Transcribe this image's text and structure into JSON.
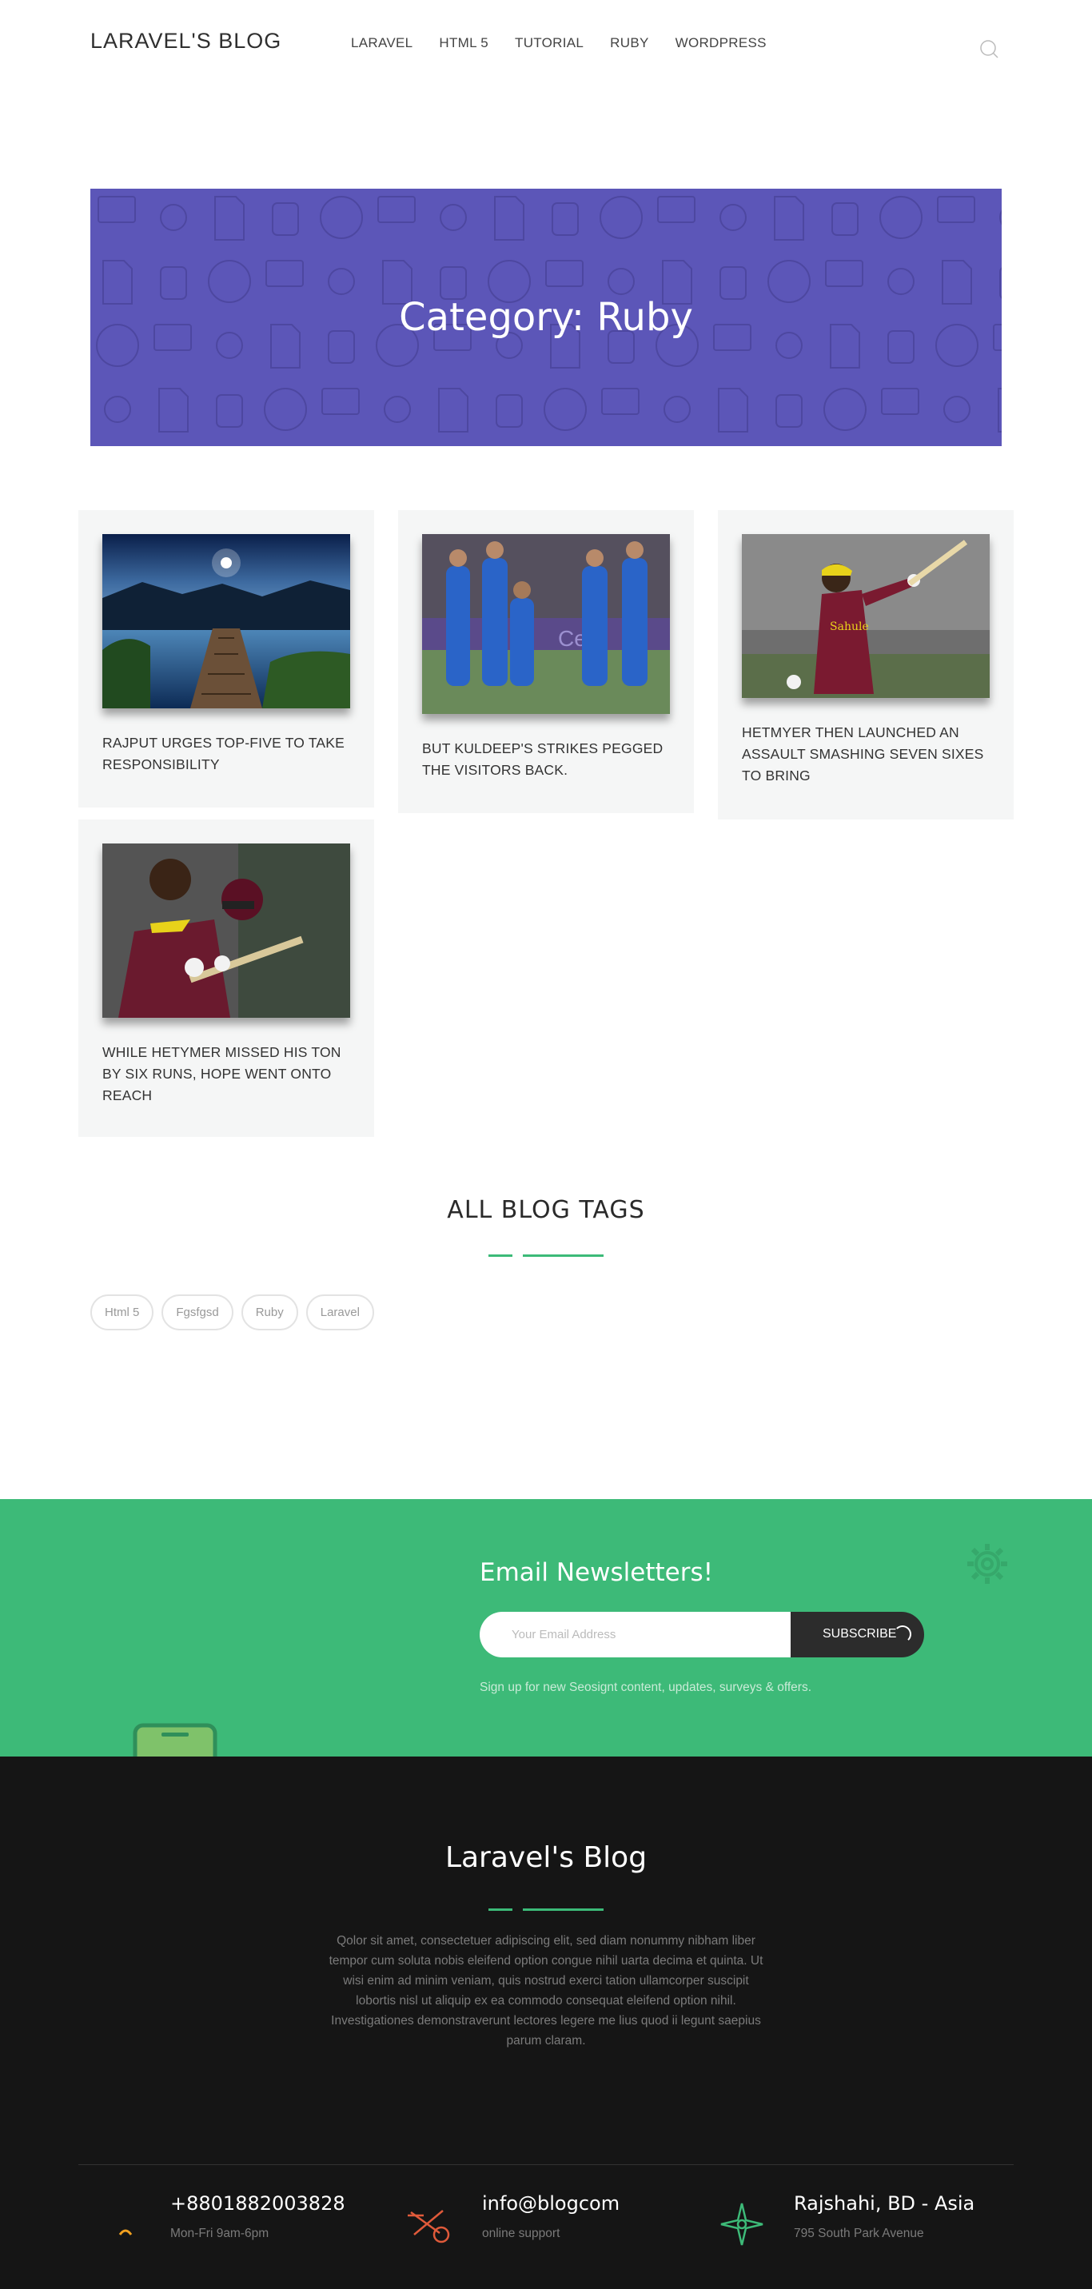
{
  "header": {
    "logo": "LARAVEL'S BLOG",
    "nav": [
      "LARAVEL",
      "HTML 5",
      "TUTORIAL",
      "RUBY",
      "WORDPRESS"
    ]
  },
  "hero": {
    "title": "Category: Ruby",
    "bg_color": "#5c56b8"
  },
  "posts": [
    {
      "title": "RAJPUT URGES TOP-FIVE TO TAKE RESPONSIBILITY"
    },
    {
      "title": "BUT KULDEEP'S STRIKES PEGGED THE VISITORS BACK."
    },
    {
      "title": "HETMYER THEN LAUNCHED AN ASSAULT SMASHING SEVEN SIXES TO BRING"
    },
    {
      "title": "WHILE HETYMER MISSED HIS TON BY SIX RUNS, HOPE WENT ONTO REACH"
    }
  ],
  "tags_section": {
    "title": "ALL BLOG TAGS",
    "tags": [
      "Html 5",
      "Fgsfgsd",
      "Ruby",
      "Laravel"
    ]
  },
  "newsletter": {
    "title": "Email Newsletters!",
    "placeholder": "Your Email Address",
    "button": "SUBSCRIBE",
    "note": "Sign up for new Seosignt content, updates, surveys & offers.",
    "bg_color": "#3dba78"
  },
  "footer": {
    "title": "Laravel's Blog",
    "text": "Qolor sit amet, consectetuer adipiscing elit, sed diam nonummy nibham liber tempor cum soluta nobis eleifend option congue nihil uarta decima et quinta. Ut wisi enim ad minim veniam, quis nostrud exerci tation ullamcorper suscipit lobortis nisl ut aliquip ex ea commodo consequat eleifend option nihil. Investigationes demonstraverunt lectores legere me lius quod ii legunt saepius parum claram.",
    "contacts": [
      {
        "main": "+8801882003828",
        "sub": "Mon-Fri 9am-6pm",
        "icon": "phone-icon"
      },
      {
        "main": "info@blogcom",
        "sub": "online support",
        "icon": "email-icon"
      },
      {
        "main": "Rajshahi, BD - Asia",
        "sub": "795 South Park Avenue",
        "icon": "location-icon"
      }
    ],
    "bg_color": "#151515"
  }
}
